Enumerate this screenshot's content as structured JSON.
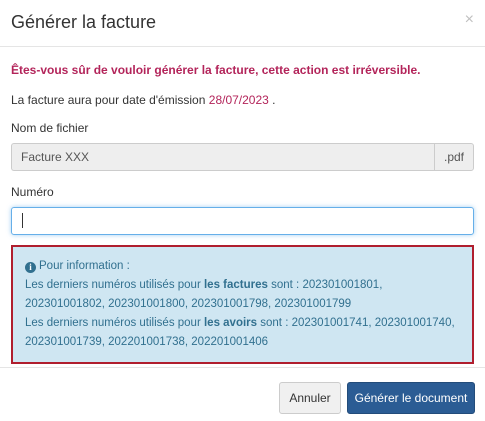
{
  "dialog": {
    "title": "Générer la facture",
    "close_glyph": "×"
  },
  "warning": "Êtes-vous sûr de vouloir générer la facture, cette action est irréversible.",
  "emission": {
    "prefix": "La facture aura pour date d'émission",
    "date": "28/07/2023",
    "suffix": "."
  },
  "filename": {
    "label": "Nom de fichier",
    "value": "Facture XXX",
    "extension": ".pdf"
  },
  "numero": {
    "label": "Numéro",
    "value": ""
  },
  "info": {
    "icon": "info-circle-icon",
    "title": "Pour information :",
    "factures": {
      "prefix": "Les derniers numéros utilisés pour",
      "bold": "les factures",
      "suffix": "sont : 202301001801, 202301001802, 202301001800, 202301001798, 202301001799"
    },
    "avoirs": {
      "prefix": "Les derniers numéros utilisés pour",
      "bold": "les avoirs",
      "suffix": "sont : 202301001741, 202301001740, 202301001739, 202201001738, 202201001406"
    }
  },
  "footer": {
    "cancel_label": "Annuler",
    "submit_label": "Générer le document"
  },
  "colors": {
    "accent": "#b3245a",
    "primary_button": "#2b5c94",
    "info_bg": "#cfe6f2",
    "info_border": "#b01e2e"
  }
}
